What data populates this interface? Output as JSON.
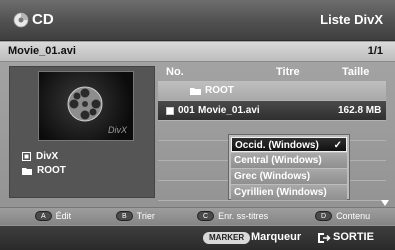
{
  "topbar": {
    "source": "CD",
    "mode": "Liste DivX",
    "disc_icon": "disc-icon"
  },
  "filebar": {
    "filename": "Movie_01.avi",
    "page": "1/1"
  },
  "left_panel": {
    "thumbnail_icon": "film-reel-icon",
    "thumbnail_logo": "DivX",
    "info": [
      {
        "icon": "divx-file-icon",
        "label": "DivX"
      },
      {
        "icon": "folder-icon",
        "label": "ROOT"
      }
    ]
  },
  "table": {
    "headers": {
      "no": "No.",
      "title": "Titre",
      "size": "Taille"
    },
    "rows": [
      {
        "type": "folder",
        "no": "",
        "title": "ROOT",
        "size": ""
      },
      {
        "type": "file",
        "no": "001",
        "title": "Movie_01.avi",
        "size": "162.8 MB"
      }
    ]
  },
  "subtitle_menu": {
    "options": [
      {
        "label": "Occid. (Windows)",
        "selected": true
      },
      {
        "label": "Central (Windows)",
        "selected": false
      },
      {
        "label": "Grec (Windows)",
        "selected": false
      },
      {
        "label": "Cyrillien (Windows)",
        "selected": false
      }
    ],
    "check": "✓"
  },
  "hints": [
    {
      "key": "A",
      "label": "Édit"
    },
    {
      "key": "B",
      "label": "Trier"
    },
    {
      "key": "C",
      "label": "Enr. ss-titres"
    },
    {
      "key": "D",
      "label": "Contenu"
    }
  ],
  "bottom": {
    "marker_key": "MARKER",
    "marker_label": "Marqueur",
    "exit_label": "SORTIE"
  },
  "colors": {
    "accent": "#2e2e2e",
    "popup_bg": "#bdbdbd",
    "text": "#ffffff"
  }
}
